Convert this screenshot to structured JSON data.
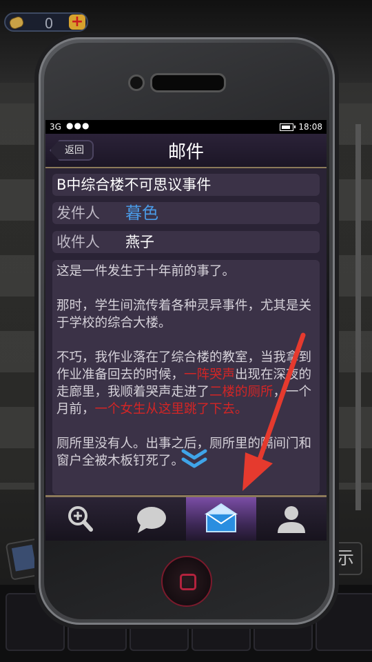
{
  "hud": {
    "coins": "0",
    "plus_label": "+"
  },
  "statusbar": {
    "network": "3G",
    "signal_dots": "●●●",
    "time": "18:08"
  },
  "navbar": {
    "back_label": "返回",
    "title": "邮件"
  },
  "email": {
    "subject": "B中综合楼不可思议事件",
    "sender_label": "发件人",
    "sender": "暮色",
    "recipient_label": "收件人",
    "recipient": "燕子",
    "body": {
      "p1": "这是一件发生于十年前的事了。",
      "p2": "那时，学生间流传着各种灵异事件，尤其是关于学校的综合大楼。",
      "p3_a": "不巧，我作业落在了综合楼的教室，当我拿到作业准备回去的时候，",
      "p3_hl1": "一阵哭声",
      "p3_b": "出现在深夜的走廊里，我顺着哭声走进了",
      "p3_hl2": "二楼的厕所",
      "p3_c": "，一个月前，",
      "p3_hl3": "一个女生从这里跳了下去。",
      "p4": "厕所里没有人。出事之后，厕所里的隔间门和窗户全被木板钉死了。"
    }
  },
  "tabs": [
    {
      "name": "search",
      "icon": "magnifier-plus-icon"
    },
    {
      "name": "chat",
      "icon": "speech-bubble-icon"
    },
    {
      "name": "mail",
      "icon": "envelope-icon",
      "active": true
    },
    {
      "name": "contacts",
      "icon": "person-icon"
    }
  ],
  "side": {
    "hint_glyph": "示"
  },
  "colors": {
    "highlight": "#d42525",
    "sender": "#4a9ae6",
    "active_tab": "#7a4da5"
  }
}
